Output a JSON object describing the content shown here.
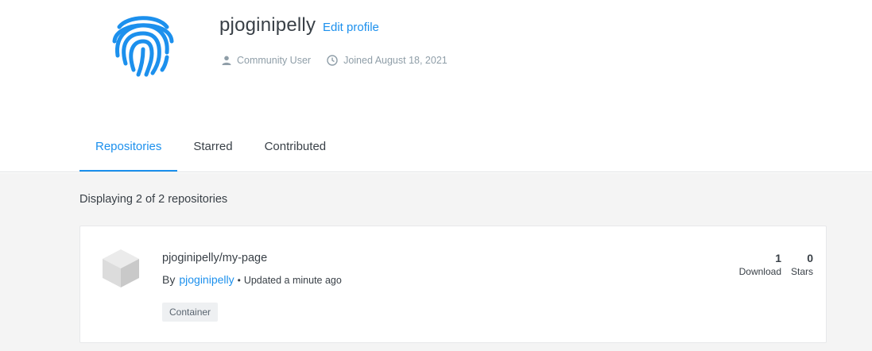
{
  "profile": {
    "username": "pjoginipelly",
    "edit_label": "Edit profile",
    "user_type": "Community User",
    "joined": "Joined August 18, 2021",
    "avatar_icon": "fingerprint-icon",
    "accent_color": "#1c90ed"
  },
  "tabs": [
    {
      "label": "Repositories",
      "active": true
    },
    {
      "label": "Starred",
      "active": false
    },
    {
      "label": "Contributed",
      "active": false
    }
  ],
  "repos_summary": "Displaying 2 of 2 repositories",
  "repositories": [
    {
      "name": "pjoginipelly/my-page",
      "by_label": "By",
      "owner": "pjoginipelly",
      "separator": "•",
      "updated": "Updated a minute ago",
      "tag": "Container",
      "downloads": "1",
      "downloads_label": "Download",
      "stars": "0",
      "stars_label": "Stars",
      "icon": "package-cube-icon"
    }
  ]
}
